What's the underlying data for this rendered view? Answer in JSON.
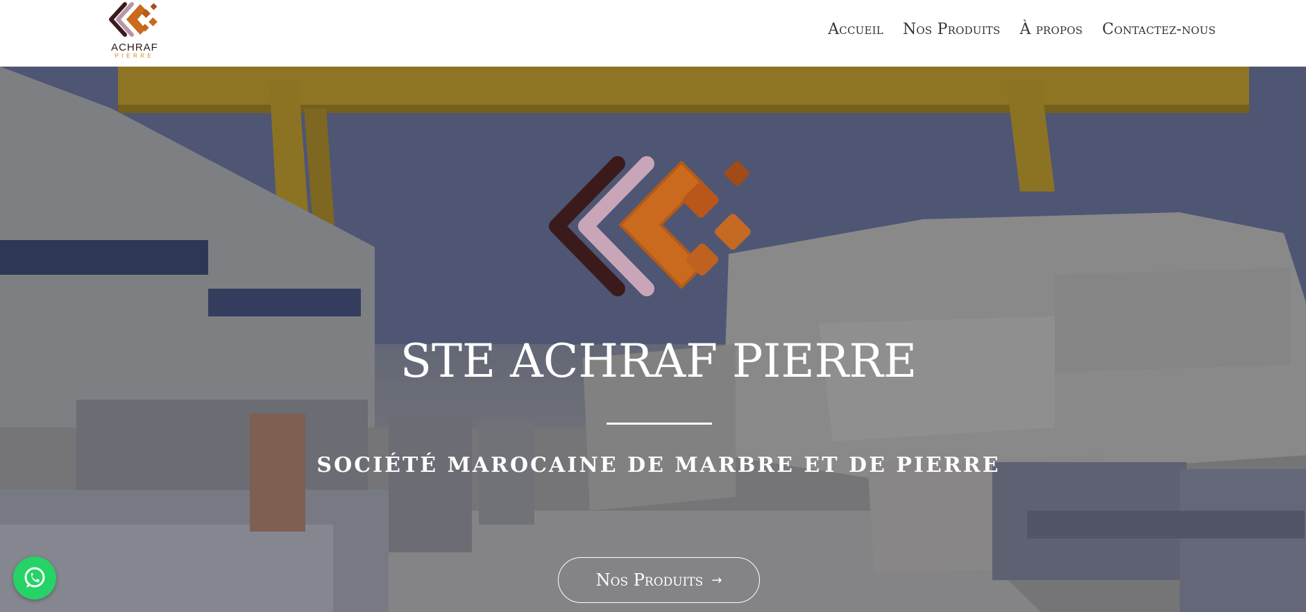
{
  "header": {
    "brand": {
      "name": "ACHRAF",
      "sub": "PIERRE"
    },
    "nav": [
      {
        "label": "Accueil"
      },
      {
        "label": "Nos Produits"
      },
      {
        "label": "À propos"
      },
      {
        "label": "Contactez-nous"
      }
    ]
  },
  "hero": {
    "title": "STE ACHRAF PIERRE",
    "subtitle": "SOCIÉTÉ MAROCAINE DE MARBRE ET DE PIERRE",
    "cta_label": "Nos Produits",
    "cta_icon": "arrow-right-icon"
  },
  "floating": {
    "whatsapp_icon": "whatsapp-icon"
  },
  "colors": {
    "accent_orange": "#d9851f",
    "logo_dark": "#3b1a1c",
    "logo_light": "#c8a6b8",
    "logo_orange": "#c96a1e",
    "whatsapp_green": "#25d366"
  }
}
